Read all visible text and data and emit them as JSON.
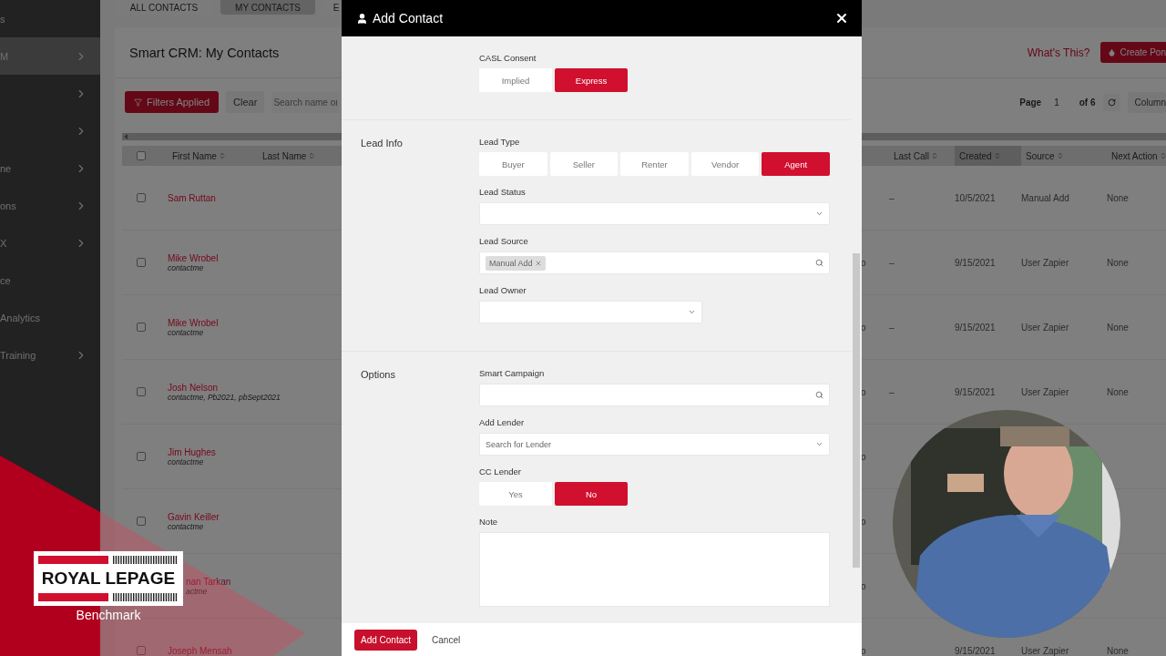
{
  "sidebar": {
    "items": [
      {
        "label": "s",
        "chevron": false,
        "selected": false
      },
      {
        "label": "M",
        "chevron": true,
        "selected": true
      },
      {
        "chevron": true,
        "selected": false
      },
      {
        "chevron": true,
        "selected": false
      },
      {
        "label": "ne",
        "chevron": true,
        "selected": false
      },
      {
        "label": "ons",
        "chevron": true,
        "selected": false
      },
      {
        "label": "X",
        "chevron": true,
        "selected": false
      },
      {
        "label": "ce",
        "chevron": false,
        "selected": false
      },
      {
        "label": "Analytics",
        "chevron": false,
        "selected": false
      },
      {
        "label": "Training",
        "chevron": true,
        "selected": false
      }
    ]
  },
  "tabs": [
    {
      "label": "ALL CONTACTS",
      "selected": false
    },
    {
      "label": "MY CONTACTS",
      "selected": true
    },
    {
      "label": "E",
      "selected": false
    }
  ],
  "page_title": "Smart CRM: My Contacts",
  "help_link": "What's This?",
  "create_button": "Create Pon",
  "filters_button": "Filters Applied",
  "clear_button": "Clear",
  "search": {
    "placeholder": "Search name or"
  },
  "pagination": {
    "label": "Page",
    "page": "1",
    "total": "of 6"
  },
  "columns_button": "Column",
  "table": {
    "select_all_checked": false,
    "columns": [
      {
        "label": "First Name",
        "sorted": false
      },
      {
        "label": "Last Name",
        "sorted": false
      },
      {
        "label": "Last Call",
        "sorted": false
      },
      {
        "label": "Created",
        "sorted": true
      },
      {
        "label": "Source",
        "sorted": false
      },
      {
        "label": "Next Action",
        "sorted": false
      }
    ],
    "rows": [
      {
        "checked": false,
        "first_name": "Sam Ruttan",
        "last_call": "–",
        "created": "10/5/2021",
        "source": "Manual Add",
        "next_action": "None"
      },
      {
        "checked": false,
        "first_name": "Mike Wrobel",
        "tags": "contactme",
        "column_3": "o",
        "last_call": "–",
        "created": "9/15/2021",
        "source": "User Zapier",
        "next_action": "None"
      },
      {
        "checked": false,
        "first_name": "Mike Wrobel",
        "tags": "contactme",
        "column_3": "o",
        "last_call": "–",
        "created": "9/15/2021",
        "source": "User Zapier",
        "next_action": "None"
      },
      {
        "checked": false,
        "first_name": "Josh Nelson",
        "tags": "contactme, Pb2021, pbSept2021",
        "column_3": "o",
        "last_call": "–",
        "created": "9/15/2021",
        "source": "User Zapier",
        "next_action": "None"
      },
      {
        "checked": false,
        "first_name": "Jim Hughes",
        "tags": "contactme",
        "column_3": "o"
      },
      {
        "checked": false,
        "first_name": "Gavin Keiller",
        "tags": "contactme",
        "column_3": "o"
      },
      {
        "first_name": "nan Tarkan",
        "tags": "actme",
        "clipped": true,
        "column_3": "o"
      },
      {
        "checked": false,
        "first_name": "Joseph Mensah",
        "column_3": "o",
        "created": "9/15/2021",
        "source": "User Zapier",
        "next_action": "None"
      }
    ]
  },
  "modal": {
    "title": "Add Contact",
    "sections": [
      {
        "fields": [
          {
            "kind": "segmented",
            "label": "CASL Consent",
            "options": [
              {
                "label": "Implied",
                "selected": false
              },
              {
                "label": "Express",
                "selected": true
              }
            ]
          }
        ]
      },
      {
        "title": "Lead Info",
        "fields": [
          {
            "kind": "segmented",
            "label": "Lead Type",
            "options": [
              {
                "label": "Buyer",
                "selected": false
              },
              {
                "label": "Seller",
                "selected": false
              },
              {
                "label": "Renter",
                "selected": false
              },
              {
                "label": "Vendor",
                "selected": false
              },
              {
                "label": "Agent",
                "selected": true
              }
            ]
          },
          {
            "kind": "select",
            "label": "Lead Status"
          },
          {
            "kind": "search",
            "label": "Lead Source",
            "tags": [
              "Manual Add"
            ]
          },
          {
            "kind": "short-select",
            "label": "Lead Owner"
          }
        ]
      },
      {
        "title": "Options",
        "fields": [
          {
            "kind": "search",
            "label": "Smart Campaign"
          },
          {
            "kind": "select",
            "label": "Add Lender",
            "placeholder": "Search for Lender"
          },
          {
            "kind": "segmented",
            "label": "CC Lender",
            "options": [
              {
                "label": "Yes",
                "selected": false
              },
              {
                "label": "No",
                "selected": true
              }
            ]
          },
          {
            "kind": "textarea",
            "label": "Note"
          }
        ]
      }
    ],
    "submit_button": "Add Contact",
    "cancel_button": "Cancel"
  },
  "brand": {
    "logo_text": "ROYAL LEPAGE",
    "office": "Benchmark"
  }
}
